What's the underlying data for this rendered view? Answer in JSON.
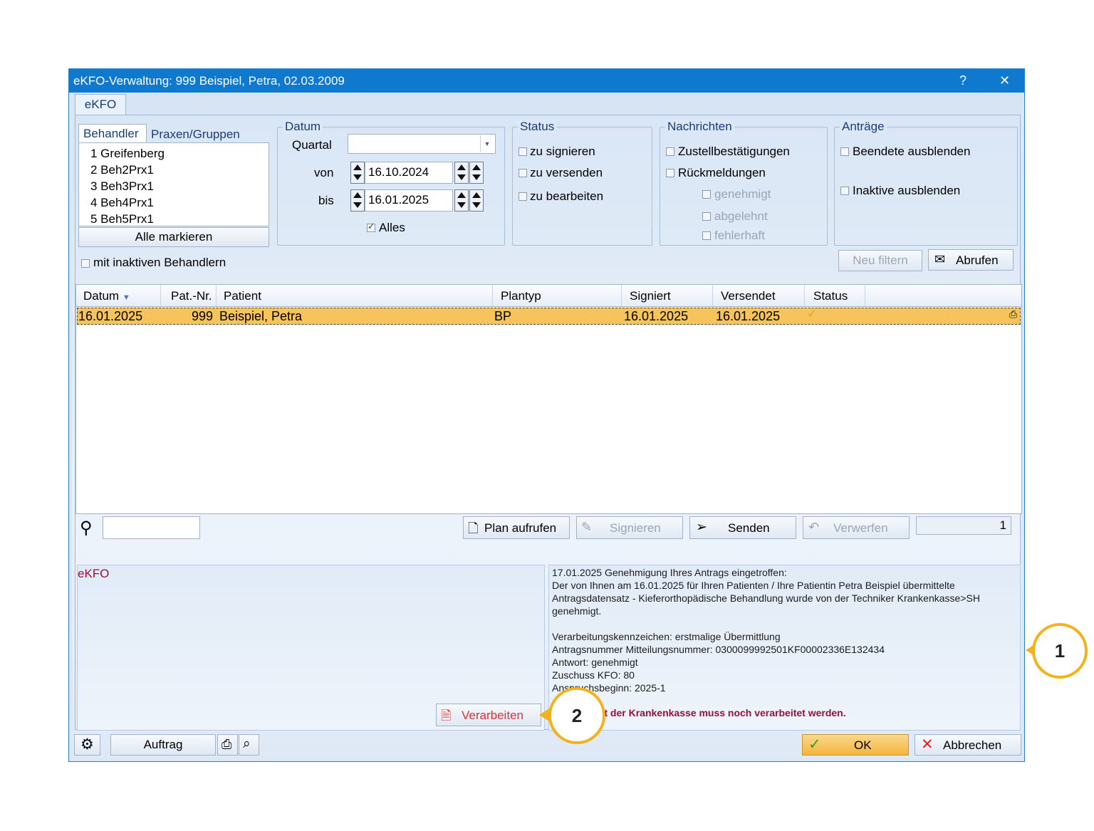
{
  "window": {
    "title": "eKFO-Verwaltung: 999 Beispiel, Petra, 02.03.2009",
    "help_label": "?",
    "close_label": "✕"
  },
  "tabs": {
    "main": "eKFO"
  },
  "behandler": {
    "tab_behandler": "Behandler",
    "tab_praxen": "Praxen/Gruppen",
    "items": [
      "1 Greifenberg",
      "2 Beh2Prx1",
      "3 Beh3Prx1",
      "4 Beh4Prx1",
      "5 Beh5Prx1"
    ],
    "select_all_label": "Alle markieren",
    "inactive_label": "mit inaktiven Behandlern"
  },
  "datum": {
    "title": "Datum",
    "quartal_label": "Quartal",
    "quartal_value": "",
    "von_label": "von",
    "von_value": "16.10.2024",
    "bis_label": "bis",
    "bis_value": "16.01.2025",
    "alles_label": "Alles"
  },
  "status": {
    "title": "Status",
    "options": [
      "zu signieren",
      "zu versenden",
      "zu bearbeiten"
    ]
  },
  "nachrichten": {
    "title": "Nachrichten",
    "zustell": "Zustellbestätigungen",
    "rueck": "Rückmeldungen",
    "genehmigt": "genehmigt",
    "abgelehnt": "abgelehnt",
    "fehlerhaft": "fehlerhaft"
  },
  "antraege": {
    "title": "Anträge",
    "beendete": "Beendete ausblenden",
    "inaktive": "Inaktive ausblenden",
    "neu_filtern": "Neu filtern",
    "abrufen": "Abrufen"
  },
  "table": {
    "headers": [
      "Datum",
      "Pat.-Nr.",
      "Patient",
      "Plantyp",
      "Signiert",
      "Versendet",
      "Status"
    ],
    "rows": [
      {
        "datum": "16.01.2025",
        "patnr": "999",
        "patient": "Beispiel, Petra",
        "plantyp": "BP",
        "signiert": "16.01.2025",
        "versendet": "16.01.2025",
        "status": "✓"
      }
    ]
  },
  "toolbar": {
    "search_value": "",
    "plan_aufrufen": "Plan aufrufen",
    "signieren": "Signieren",
    "senden": "Senden",
    "verwerfen": "Verwerfen",
    "count": "1"
  },
  "detail": {
    "left_title": "eKFO",
    "verarbeiten": "Verarbeiten",
    "lines": [
      "17.01.2025 Genehmigung Ihres Antrags eingetroffen:",
      "Der von Ihnen am 16.01.2025 für Ihren Patienten / Ihre Patientin Petra Beispiel übermittelte",
      "Antragsdatensatz - Kieferorthopädische Behandlung wurde von der Techniker Krankenkasse>SH",
      "genehmigt.",
      "",
      "Verarbeitungskennzeichen: erstmalige Übermittlung",
      "Antragsnummer Mitteilungsnummer: 0300099992501KF00002336E132434",
      "Antwort: genehmigt",
      "Zuschuss KFO: 80",
      "Anspruchsbeginn: 2025-1"
    ],
    "warning": "Die Antwort der Krankenkasse muss noch verarbeitet werden."
  },
  "footer": {
    "auftrag": "Auftrag",
    "ok": "OK",
    "abbrechen": "Abbrechen"
  },
  "callouts": [
    "1",
    "2"
  ],
  "colors": {
    "titlebar": "#0f79d0",
    "selected_row": "#f6c45a",
    "warning_text": "#9b0f3c",
    "callout_ring": "#f4b21a"
  }
}
